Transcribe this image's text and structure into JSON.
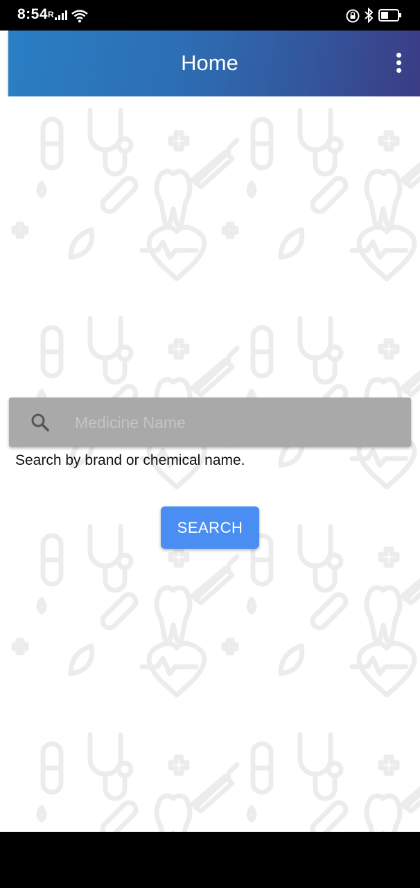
{
  "status_bar": {
    "time": "8:54",
    "carrier_indicator": "R",
    "icons": [
      "signal-icon",
      "wifi-icon",
      "alarm-icon",
      "bluetooth-icon",
      "battery-icon"
    ]
  },
  "app_bar": {
    "title": "Home",
    "menu_icon": "more-vert-icon",
    "gradient_start": "#2a7fc4",
    "gradient_end": "#3b3c84"
  },
  "search": {
    "icon": "search-icon",
    "placeholder": "Medicine Name",
    "value": "",
    "hint": "Search by brand or chemical name.",
    "button_label": "SEARCH",
    "button_color": "#4a8ef3"
  },
  "background_pattern": {
    "icons": [
      "pill-icon",
      "stethoscope-icon",
      "cross-icon",
      "syringe-icon",
      "tooth-icon",
      "heart-pulse-icon",
      "leaf-icon",
      "drop-icon"
    ]
  }
}
